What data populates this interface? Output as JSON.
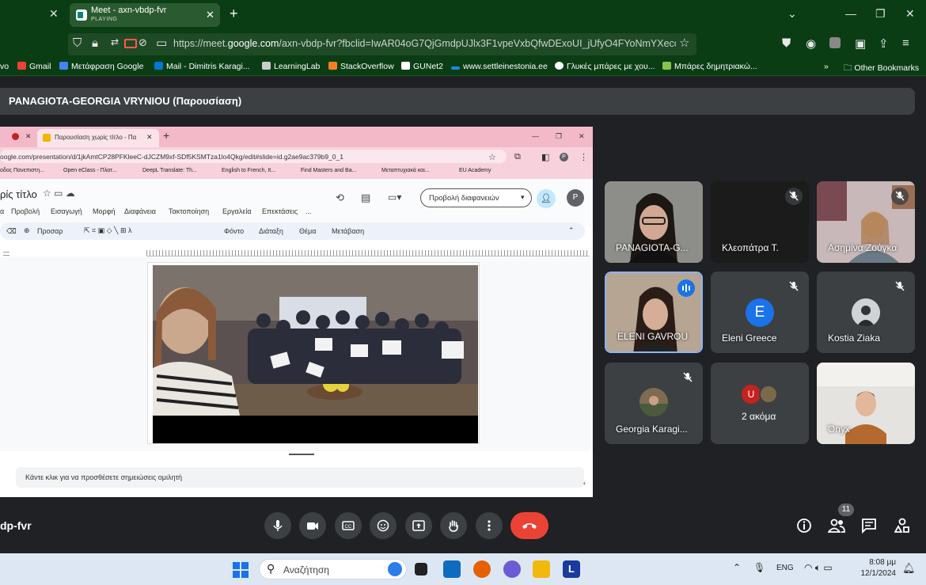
{
  "browser": {
    "tab_title": "Meet - axn-vbdp-fvr",
    "tab_status": "PLAYING",
    "url_prefix": "https://meet.",
    "url_domain": "google.com",
    "url_suffix": "/axn-vbdp-fvr?fbclid=IwAR04oG7QjGmdpUJlx3F1vpeVxbQfwDExoUI_jUfyO4FYoNmYXeccQU77m",
    "bookmarks": [
      "vo",
      "Gmail",
      "Μετάφραση Google",
      "Mail - Dimitris Karagi...",
      "LearningLab",
      "StackOverflow",
      "GUNet2",
      "www.settleinestonia.ee",
      "Γλυκές μπάρες με χου...",
      "Μπάρες δημητριακώ..."
    ],
    "other_bookmarks": "Other Bookmarks",
    "accent": "#0b3d14"
  },
  "meet": {
    "presenter_label": "PANAGIOTA-GEORGIA VRYNIOU (Παρουσίαση)",
    "meeting_code": "dp-fvr",
    "participant_count": "11",
    "more_label": "2 ακόμα",
    "participants": [
      {
        "name": "PANAGIOTA-G...",
        "muted": false
      },
      {
        "name": "Κλεοπάτρα Τ.",
        "muted": true
      },
      {
        "name": "Ασημίνα Ζούγκα",
        "muted": true
      },
      {
        "name": "ELENI GAVROU",
        "muted": false,
        "speaking": true
      },
      {
        "name": "Eleni Greece",
        "muted": true,
        "initial": "E"
      },
      {
        "name": "Kostia Ziaka",
        "muted": true
      },
      {
        "name": "Georgia Karagi...",
        "muted": true
      },
      {
        "name": "Όnyx",
        "muted": false
      }
    ]
  },
  "shared": {
    "tab_title": "Παρουσίαση χωρίς τίτλο - Πα",
    "url": "oogle.com/presentation/d/1jkAmtCP28PFKleeC-dJCZM9xf-SDf5KSMTza1lo4Qkg/edit#slide=id.g2ae9ac379b9_0_1",
    "bookmarks": [
      "οδος Πανεπιστη...",
      "Open eClass - Πλατ...",
      "DeepL Translate: Th...",
      "English to French, It...",
      "Find Masters and Ba...",
      "Μεταπτυχιακά και...",
      "EU Academy"
    ],
    "doc_title": "ρίς τίτλο",
    "menu": [
      "α",
      "Προβολή",
      "Εισαγωγή",
      "Μορφή",
      "Διαφάνεια",
      "Τακτοποίηση",
      "Εργαλεία",
      "Επεκτάσεις",
      "..."
    ],
    "slideshow_button": "Προβολή διαφανειών",
    "toolbar": [
      "Προσαρ",
      "Φόντο",
      "Διάταξη",
      "Θέμα",
      "Μετάβαση"
    ],
    "notes_placeholder": "Κάντε κλικ για να προσθέσετε σημειώσεις ομιλητή",
    "avatar_letter": "P"
  },
  "taskbar": {
    "search_placeholder": "Αναζήτηση",
    "lang": "ENG",
    "time": "8:08 μμ",
    "date": "12/1/2024"
  }
}
